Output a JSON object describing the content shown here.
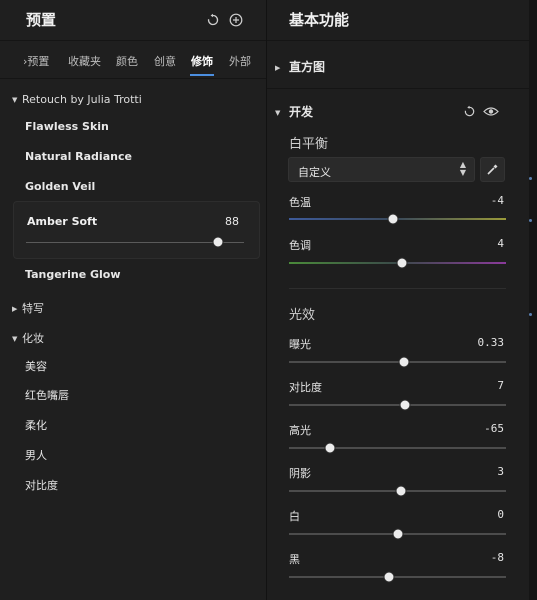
{
  "left_panel": {
    "title": "预置",
    "tabs": [
      "›预置",
      "收藏夹",
      "颜色",
      "创意",
      "修饰",
      "外部"
    ],
    "active_tab": "修饰",
    "group_open": "Retouch by Julia Trotti",
    "presets": [
      "Flawless Skin",
      "Natural Radiance",
      "Golden Veil"
    ],
    "selected_preset": {
      "name": "Amber Soft",
      "amount": "88",
      "amount_fraction": 0.88
    },
    "after_preset": "Tangerine Glow",
    "group_closed": "特写",
    "group_makeup": "化妆",
    "makeup_items": [
      "美容",
      "红色嘴唇",
      "柔化",
      "男人",
      "对比度"
    ]
  },
  "right_panel": {
    "title": "基本功能",
    "histogram": "直方图",
    "develop": "开发",
    "white_balance": "白平衡",
    "wb_select": "自定义",
    "temp": {
      "label": "色温",
      "value": "-4",
      "fraction": 0.48
    },
    "tint": {
      "label": "色调",
      "value": "4",
      "fraction": 0.52
    },
    "light": "光效",
    "sliders": [
      {
        "label": "曝光",
        "value": "0.33",
        "fraction": 0.53
      },
      {
        "label": "对比度",
        "value": "7",
        "fraction": 0.535
      },
      {
        "label": "高光",
        "value": "-65",
        "fraction": 0.19
      },
      {
        "label": "阴影",
        "value": "3",
        "fraction": 0.515
      },
      {
        "label": "白",
        "value": "0",
        "fraction": 0.5
      },
      {
        "label": "黑",
        "value": "-8",
        "fraction": 0.46
      }
    ]
  },
  "colors": {
    "accent": "#4c8fe0",
    "panel": "#1f1f1f",
    "text": "#e6e6e6"
  }
}
